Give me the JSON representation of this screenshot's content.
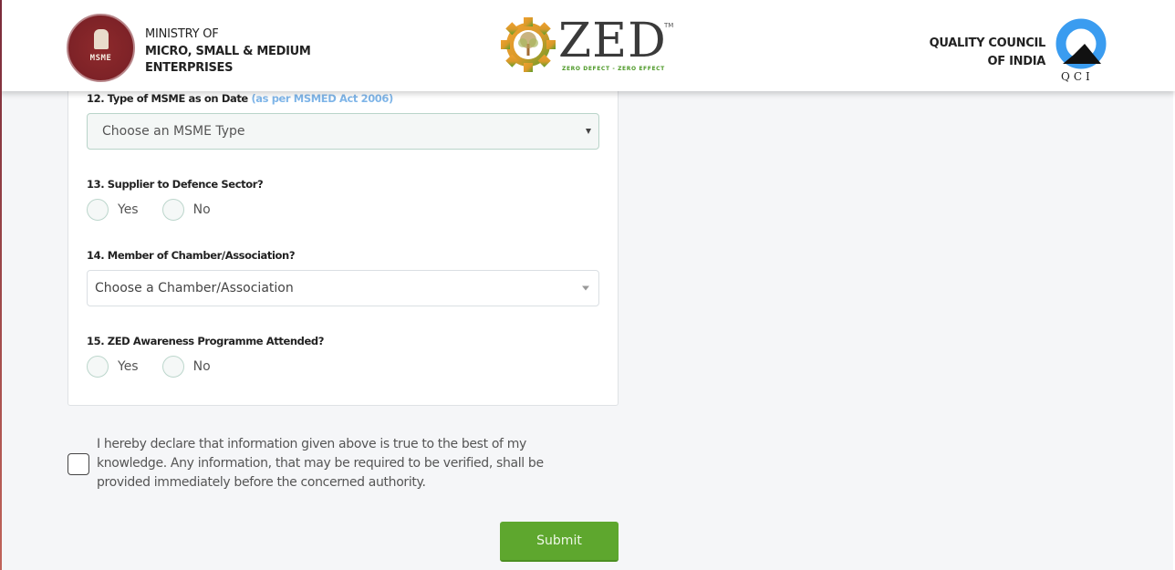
{
  "header": {
    "ministry": {
      "line1": "MINISTRY OF",
      "line2": "MICRO, SMALL & MEDIUM",
      "line3": "ENTERPRISES",
      "logo_text": "MSME",
      "logo_icon": "msme-emblem-icon"
    },
    "zed": {
      "word": "ZED",
      "tm": "TM",
      "tagline": "ZERO DEFECT - ZERO EFFECT",
      "logo_icon": "zed-gear-tree-icon"
    },
    "qci": {
      "line1": "QUALITY COUNCIL",
      "line2": "OF INDIA",
      "letters": "QCI",
      "logo_icon": "qci-q-icon"
    }
  },
  "form": {
    "q12": {
      "label": "12. Type of MSME as on Date",
      "hint": "(as per MSMED Act 2006)",
      "placeholder": "Choose an MSME Type"
    },
    "q13": {
      "label": "13. Supplier to Defence Sector?",
      "options": [
        "Yes",
        "No"
      ]
    },
    "q14": {
      "label": "14. Member of Chamber/Association?",
      "placeholder": "Choose a Chamber/Association"
    },
    "q15": {
      "label": "15. ZED Awareness Programme Attended?",
      "options": [
        "Yes",
        "No"
      ]
    }
  },
  "declaration": {
    "text": "I hereby declare that information given above is true to the best of my knowledge. Any information, that may be required to be verified, shall be provided immediately before the concerned authority.",
    "checked": false
  },
  "submit_label": "Submit",
  "colors": {
    "accent_green": "#5ea72e",
    "hint_blue": "#7fb5e8",
    "msme_maroon": "#7d2227",
    "qci_blue": "#3a9cf0"
  }
}
